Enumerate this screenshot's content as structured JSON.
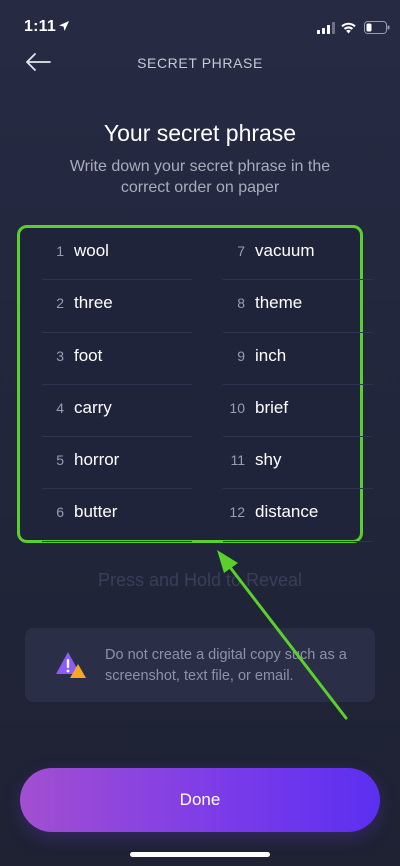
{
  "status_bar": {
    "time": "1:11"
  },
  "nav": {
    "title": "SECRET PHRASE"
  },
  "header": {
    "title": "Your secret phrase",
    "subtitle": "Write down your secret phrase in the correct order on paper"
  },
  "phrase": {
    "words": [
      {
        "num": "1",
        "word": "wool"
      },
      {
        "num": "2",
        "word": "three"
      },
      {
        "num": "3",
        "word": "foot"
      },
      {
        "num": "4",
        "word": "carry"
      },
      {
        "num": "5",
        "word": "horror"
      },
      {
        "num": "6",
        "word": "butter"
      },
      {
        "num": "7",
        "word": "vacuum"
      },
      {
        "num": "8",
        "word": "theme"
      },
      {
        "num": "9",
        "word": "inch"
      },
      {
        "num": "10",
        "word": "brief"
      },
      {
        "num": "11",
        "word": "shy"
      },
      {
        "num": "12",
        "word": "distance"
      }
    ],
    "highlight_color": "#59d02c"
  },
  "reveal": {
    "label": "Press and Hold to Reveal"
  },
  "warning": {
    "text": "Do not create a digital copy such as a screenshot, text file, or email.",
    "icon": "warning-triangle-icon"
  },
  "done_button": {
    "label": "Done"
  },
  "colors": {
    "accent_start": "#a24fd1",
    "accent_end": "#5b2ff0",
    "annotation": "#59d02c"
  }
}
